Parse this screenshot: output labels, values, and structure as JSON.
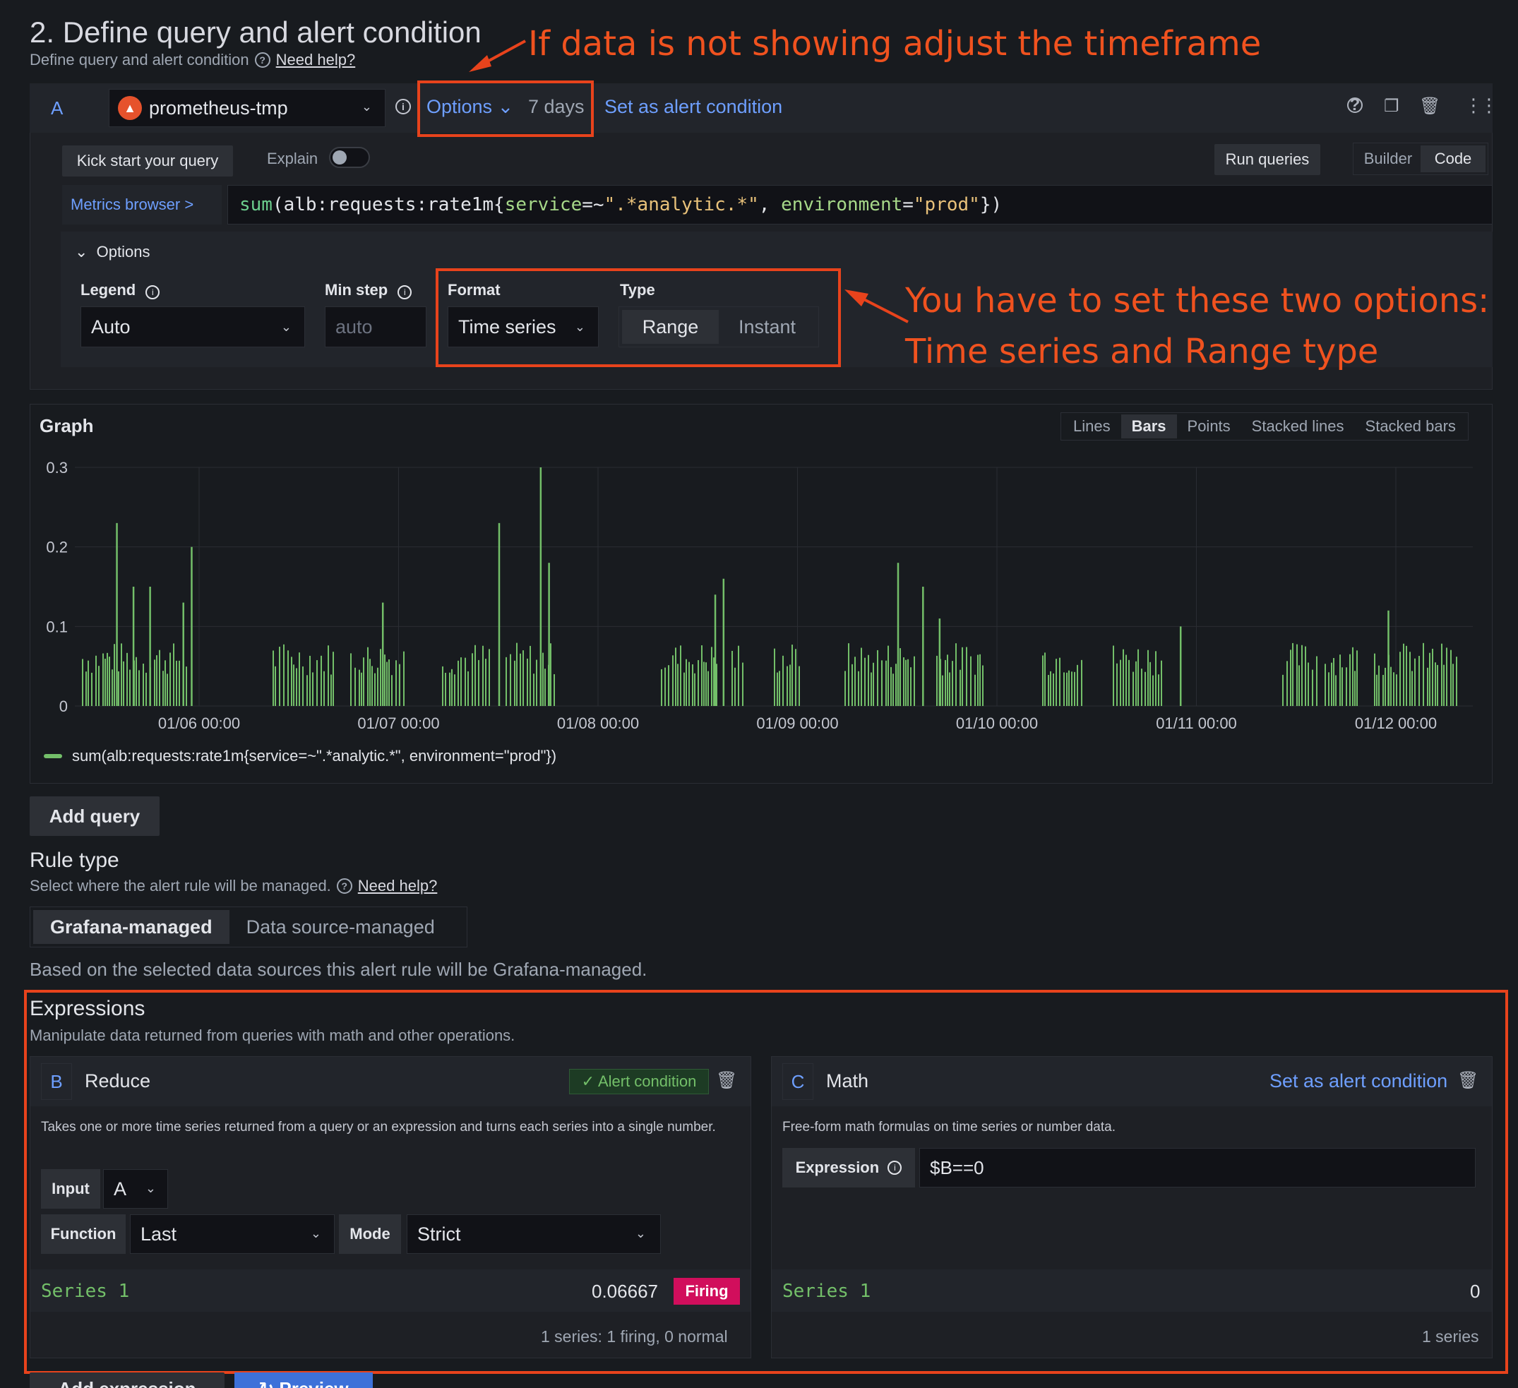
{
  "header": {
    "title": "2. Define query and alert condition",
    "subtitle": "Define query and alert condition",
    "help_link": "Need help?"
  },
  "annotations": {
    "timeframe": "If data is not showing adjust the timeframe",
    "options_line1": "You have to set these two options:",
    "options_line2": "Time series and Range type",
    "color": "#e8431c"
  },
  "query": {
    "ref_id": "A",
    "datasource": "prometheus-tmp",
    "datasource_icon": "prometheus-icon",
    "options_label": "Options",
    "time_range": "7 days",
    "set_alert_label": "Set as alert condition",
    "kickstart_label": "Kick start your query",
    "explain_label": "Explain",
    "explain_on": false,
    "run_label": "Run queries",
    "editor_modes": [
      "Builder",
      "Code"
    ],
    "editor_mode_active": "Code",
    "metrics_browser_label": "Metrics browser >",
    "expr_parts": {
      "fn": "sum",
      "open": "(alb:requests:rate1m{",
      "lbl1": "service",
      "op1": "=~",
      "val1": "\".*analytic.*\"",
      "sep": ", ",
      "lbl2": "environment",
      "op2": "=",
      "val2": "\"prod\"",
      "close": "})"
    },
    "options": {
      "toggle_label": "Options",
      "legend_label": "Legend",
      "legend_value": "Auto",
      "minstep_label": "Min step",
      "minstep_placeholder": "auto",
      "format_label": "Format",
      "format_value": "Time series",
      "type_label": "Type",
      "type_options": [
        "Range",
        "Instant"
      ],
      "type_active": "Range"
    }
  },
  "graph": {
    "title": "Graph",
    "styles": [
      "Lines",
      "Bars",
      "Points",
      "Stacked lines",
      "Stacked bars"
    ],
    "style_active": "Bars",
    "legend": "sum(alb:requests:rate1m{service=~\".*analytic.*\", environment=\"prod\"})",
    "color": "#73bf69"
  },
  "chart_data": {
    "type": "bar",
    "x_ticks": [
      "01/06 00:00",
      "01/07 00:00",
      "01/08 00:00",
      "01/09 00:00",
      "01/10 00:00",
      "01/11 00:00",
      "01/12 00:00"
    ],
    "y_ticks": [
      "0",
      "0.1",
      "0.2",
      "0.3"
    ],
    "ylim": [
      0,
      0.3
    ],
    "grid": true,
    "series": [
      {
        "name": "sum(alb:requests:rate1m{service=~\".*analytic.*\", environment=\"prod\"})",
        "peaks": [
          {
            "x": "01/05 14:00",
            "y": 0.23
          },
          {
            "x": "01/05 16:00",
            "y": 0.15
          },
          {
            "x": "01/05 18:00",
            "y": 0.15
          },
          {
            "x": "01/05 22:00",
            "y": 0.13
          },
          {
            "x": "01/05 23:00",
            "y": 0.2
          },
          {
            "x": "01/06 22:00",
            "y": 0.13
          },
          {
            "x": "01/07 12:00",
            "y": 0.23
          },
          {
            "x": "01/07 17:00",
            "y": 0.3
          },
          {
            "x": "01/07 18:00",
            "y": 0.18
          },
          {
            "x": "01/08 14:00",
            "y": 0.14
          },
          {
            "x": "01/08 15:00",
            "y": 0.16
          },
          {
            "x": "01/09 12:00",
            "y": 0.18
          },
          {
            "x": "01/09 15:00",
            "y": 0.15
          },
          {
            "x": "01/09 17:00",
            "y": 0.11
          },
          {
            "x": "01/10 22:00",
            "y": 0.1
          },
          {
            "x": "01/11 23:00",
            "y": 0.12
          }
        ],
        "baseline": 0.07
      }
    ]
  },
  "add_query_label": "Add query",
  "rule_type": {
    "title": "Rule type",
    "subtitle": "Select where the alert rule will be managed.",
    "help_link": "Need help?",
    "options": [
      "Grafana-managed",
      "Data source-managed"
    ],
    "active": "Grafana-managed",
    "note": "Based on the selected data sources this alert rule will be Grafana-managed."
  },
  "expressions": {
    "title": "Expressions",
    "subtitle": "Manipulate data returned from queries with math and other operations.",
    "reduce": {
      "ref_id": "B",
      "name": "Reduce",
      "alert_badge": "✓ Alert condition",
      "description": "Takes one or more time series returned from a query or an expression and turns each series into a single number.",
      "input_label": "Input",
      "input_value": "A",
      "function_label": "Function",
      "function_value": "Last",
      "mode_label": "Mode",
      "mode_value": "Strict",
      "series_name": "Series 1",
      "series_value": "0.06667",
      "state": "Firing",
      "footer": "1 series: 1 firing, 0 normal"
    },
    "math": {
      "ref_id": "C",
      "name": "Math",
      "set_alert_label": "Set as alert condition",
      "description": "Free-form math formulas on time series or number data.",
      "expression_label": "Expression",
      "expression_value": "$B==0",
      "series_name": "Series 1",
      "series_value": "0",
      "footer": "1 series"
    }
  },
  "footer_buttons": {
    "add_expression": "Add expression",
    "preview": "Preview"
  }
}
